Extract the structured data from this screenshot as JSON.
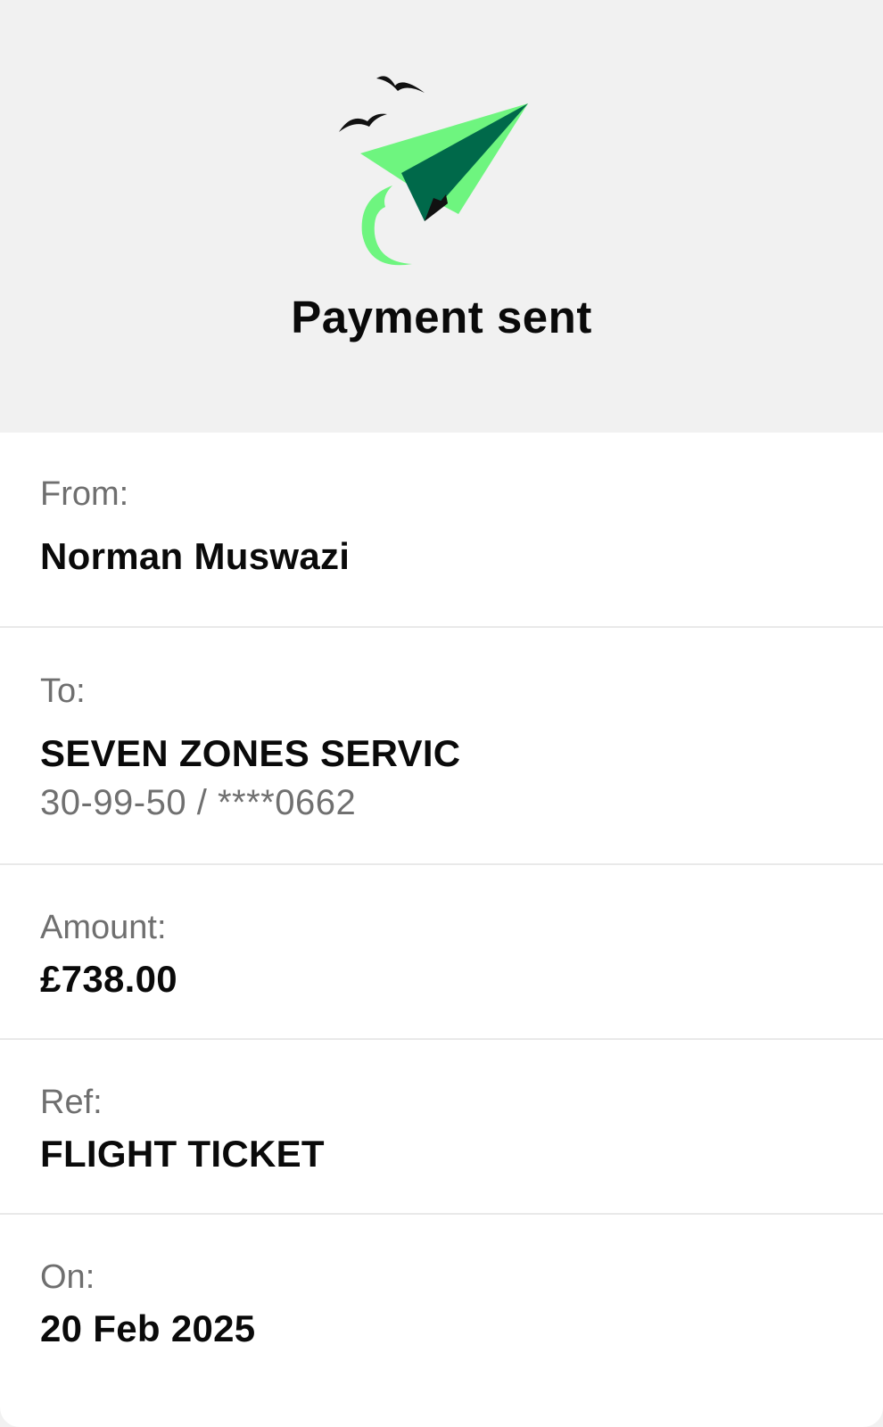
{
  "header": {
    "title": "Payment sent",
    "illustration_icon": "paper-plane-icon",
    "accent_light": "#6ef57f",
    "accent_dark": "#00694a"
  },
  "details": {
    "from": {
      "label": "From:",
      "value": "Norman Muswazi"
    },
    "to": {
      "label": "To:",
      "value": "SEVEN ZONES SERVIC",
      "account": "30-99-50 / ****0662"
    },
    "amount": {
      "label": "Amount:",
      "value": "£738.00"
    },
    "ref": {
      "label": "Ref:",
      "value": "FLIGHT TICKET"
    },
    "on": {
      "label": "On:",
      "value": "20 Feb 2025"
    }
  }
}
